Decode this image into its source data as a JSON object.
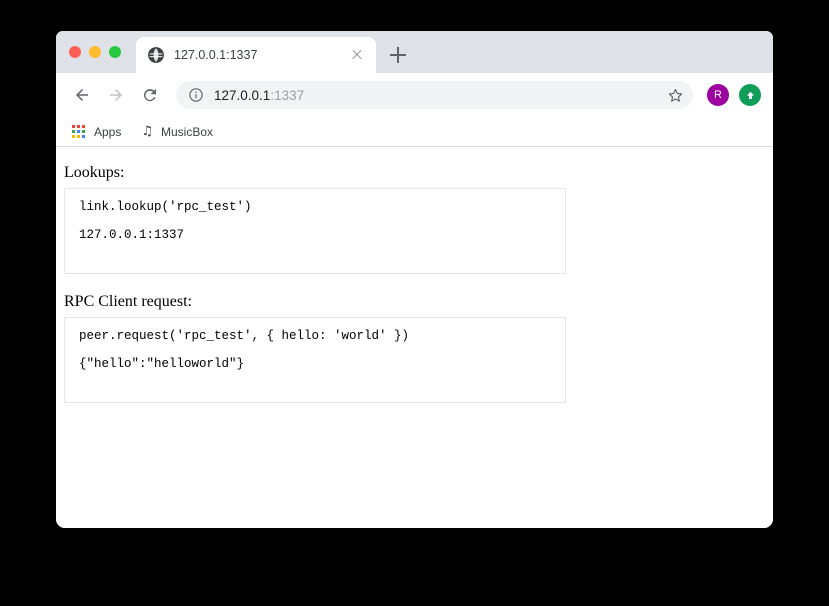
{
  "window": {
    "traffic_lights": [
      {
        "name": "close",
        "color": "#ff5f56"
      },
      {
        "name": "minimize",
        "color": "#ffbd2e"
      },
      {
        "name": "maximize",
        "color": "#28c840"
      }
    ]
  },
  "tab": {
    "title": "127.0.0.1:1337",
    "favicon": "globe-icon",
    "close_icon": "close-icon",
    "new_tab_icon": "plus-icon"
  },
  "toolbar": {
    "back_icon": "back-arrow-icon",
    "forward_icon": "forward-arrow-icon",
    "reload_icon": "reload-icon",
    "info_icon": "info-circle-icon",
    "url_host": "127.0.0.1",
    "url_port": ":1337",
    "star_icon": "star-outline-icon",
    "avatar_initial": "R",
    "avatar_color": "#9c00a0",
    "update_icon": "arrow-up-circle-icon",
    "update_color": "#0f9d58"
  },
  "bookmarks": {
    "items": [
      {
        "label": "Apps",
        "icon": "apps-grid-icon"
      },
      {
        "label": "MusicBox",
        "icon": "music-note-icon"
      }
    ]
  },
  "page": {
    "sections": [
      {
        "heading": "Lookups:",
        "lines": [
          "link.lookup('rpc_test')",
          "127.0.0.1:1337"
        ]
      },
      {
        "heading": "RPC Client request:",
        "lines": [
          "peer.request('rpc_test', { hello: 'world' })",
          "{\"hello\":\"helloworld\"}"
        ]
      }
    ]
  }
}
